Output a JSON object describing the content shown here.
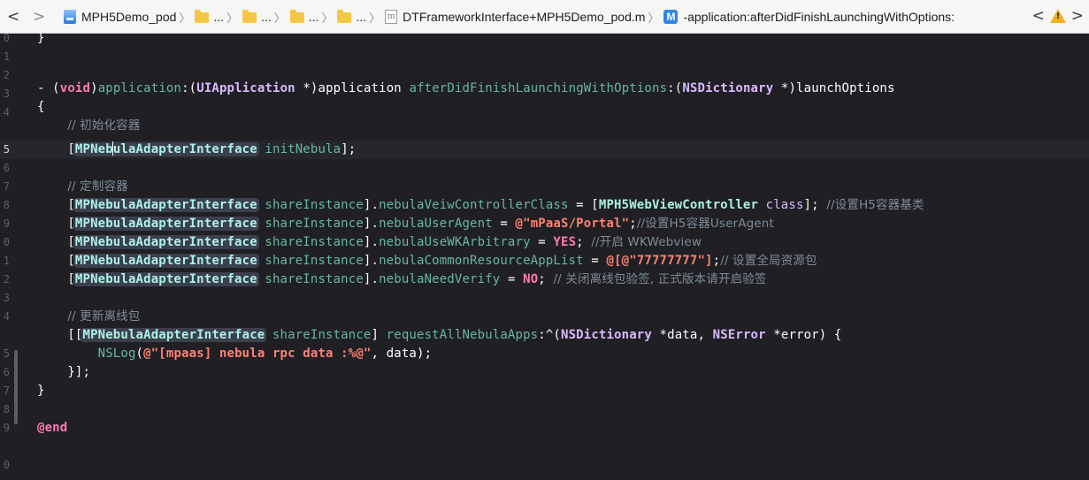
{
  "jumpbar": {
    "nav_back": "<",
    "nav_forward": ">",
    "crumbs": [
      {
        "type": "project",
        "label": "MPH5Demo_pod"
      },
      {
        "type": "folder",
        "label": "..."
      },
      {
        "type": "folder",
        "label": "..."
      },
      {
        "type": "folder",
        "label": "..."
      },
      {
        "type": "folder",
        "label": "..."
      },
      {
        "type": "file",
        "label": "DTFrameworkInterface+MPH5Demo_pod.m",
        "icon_glyph": "m"
      },
      {
        "type": "method",
        "label": "-application:afterDidFinishLaunchingWithOptions:",
        "icon_glyph": "M"
      }
    ],
    "issue_prev": "<",
    "issue_next": ">",
    "warning_glyph": "!"
  },
  "editor": {
    "line_numbers": [
      "0",
      "1",
      "2",
      "3",
      "4",
      "5",
      "6",
      "7",
      "8",
      "9",
      "0",
      "1",
      "2",
      "3",
      "4",
      "5",
      "6",
      "7",
      "8",
      "9",
      "0"
    ],
    "current_line_index": 5,
    "lines": {
      "l0_brace": "}",
      "l2_dash": "- ",
      "l2_void": "void",
      "l2_sel1": "application",
      "l2_type1": "UIApplication",
      "l2_star1": " *)",
      "l2_param1": "application",
      "l2_sel2": "afterDidFinishLaunchingWithOptions",
      "l2_type2": "NSDictionary",
      "l2_star2": " *)",
      "l2_param2": "launchOptions",
      "l3_brace": "{",
      "l4_comment": "// 初始化容器",
      "l5_class_a": "MPNeb",
      "l5_class_b": "ulaAdapterInterface",
      "l5_method": "initNebula",
      "l7_comment": "// 定制容器",
      "class_name": "MPNebulaAdapterInterface",
      "share_instance": "shareInstance",
      "l8_prop": "nebulaVeiwControllerClass",
      "l8_class": "MPH5WebViewController",
      "l8_kw": "class",
      "l8_comment": "//设置H5容器基类",
      "l9_prop": "nebulaUserAgent",
      "l9_str": "@\"mPaaS/Portal\"",
      "l9_comment": "//设置H5容器UserAgent",
      "l10_prop": "nebulaUseWKArbitrary",
      "l10_val": "YES",
      "l10_comment": "//开启 WKWebview",
      "l11_prop": "nebulaCommonResourceAppList",
      "l11_str_open": "@[",
      "l11_str": "@\"77777777\"",
      "l11_str_close": "]",
      "l11_comment": "// 设置全局资源包",
      "l12_prop": "nebulaNeedVerify",
      "l12_val": "NO",
      "l12_comment": "// 关闭离线包验签, 正式版本请开启验签",
      "l14_comment": "// 更新离线包",
      "l15_method": "requestAllNebulaApps",
      "l15_type1": "NSDictionary",
      "l15_param1": "data",
      "l15_type2": "NSError",
      "l15_param2": "error",
      "l16_fn": "NSLog",
      "l16_str": "@\"[mpaas] nebula rpc data :%@\"",
      "l16_arg": "data",
      "l17_close": "}];",
      "l18_brace": "}",
      "l20_end": "@end"
    }
  }
}
